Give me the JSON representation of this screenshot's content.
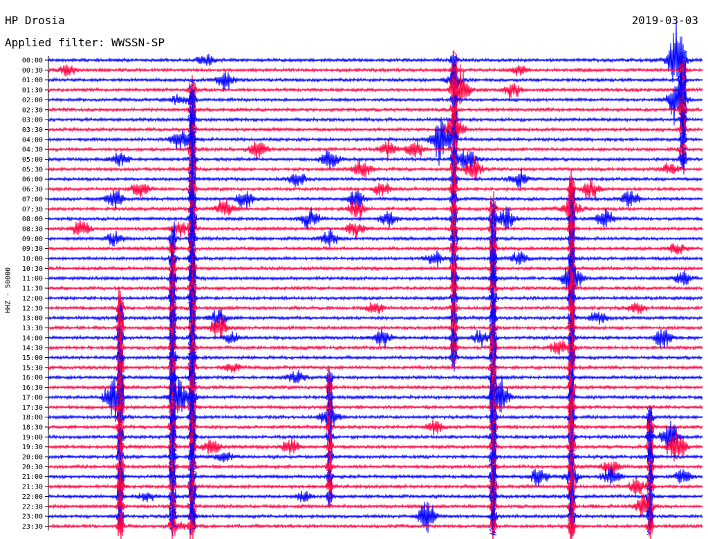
{
  "header": {
    "station": "HP Drosia",
    "date": "2019-03-03",
    "filter": "Applied filter: WWSSN-SP"
  },
  "colors": {
    "blue": "#0000ff",
    "red": "#ff0040",
    "axis": "#000000"
  },
  "chart_data": {
    "type": "line",
    "title": "HP Drosia",
    "ylabel": "HHZ - 50000",
    "row_labels": [
      "00:00",
      "00:30",
      "01:00",
      "01:30",
      "02:00",
      "02:30",
      "03:00",
      "03:30",
      "04:00",
      "04:30",
      "05:00",
      "05:30",
      "06:00",
      "06:30",
      "07:00",
      "07:30",
      "08:00",
      "08:30",
      "09:00",
      "09:30",
      "10:00",
      "10:30",
      "11:00",
      "11:30",
      "12:00",
      "12:30",
      "13:00",
      "13:30",
      "14:00",
      "14:30",
      "15:00",
      "15:30",
      "16:00",
      "16:30",
      "17:00",
      "17:30",
      "18:00",
      "18:30",
      "19:00",
      "19:30",
      "20:00",
      "20:30",
      "21:00",
      "21:30",
      "22:00",
      "22:30",
      "23:00",
      "23:30"
    ],
    "row_colors": [
      "blue",
      "red"
    ],
    "grid": false,
    "legend": "none",
    "events": [
      {
        "row": 0,
        "x": 0.24,
        "amp": 8
      },
      {
        "row": 0,
        "x": 0.96,
        "amp": 40
      },
      {
        "row": 1,
        "x": 0.03,
        "amp": 8
      },
      {
        "row": 1,
        "x": 0.72,
        "amp": 6
      },
      {
        "row": 2,
        "x": 0.27,
        "amp": 12
      },
      {
        "row": 2,
        "x": 0.62,
        "amp": 8
      },
      {
        "row": 3,
        "x": 0.71,
        "amp": 12
      },
      {
        "row": 3,
        "x": 0.63,
        "amp": 30
      },
      {
        "row": 4,
        "x": 0.2,
        "amp": 6
      },
      {
        "row": 4,
        "x": 0.96,
        "amp": 30
      },
      {
        "row": 7,
        "x": 0.62,
        "amp": 25
      },
      {
        "row": 8,
        "x": 0.6,
        "amp": 30
      },
      {
        "row": 8,
        "x": 0.2,
        "amp": 14
      },
      {
        "row": 9,
        "x": 0.32,
        "amp": 12
      },
      {
        "row": 9,
        "x": 0.52,
        "amp": 10
      },
      {
        "row": 9,
        "x": 0.56,
        "amp": 12
      },
      {
        "row": 10,
        "x": 0.11,
        "amp": 10
      },
      {
        "row": 10,
        "x": 0.43,
        "amp": 14
      },
      {
        "row": 10,
        "x": 0.64,
        "amp": 18
      },
      {
        "row": 11,
        "x": 0.48,
        "amp": 12
      },
      {
        "row": 11,
        "x": 0.95,
        "amp": 8
      },
      {
        "row": 11,
        "x": 0.65,
        "amp": 16
      },
      {
        "row": 12,
        "x": 0.72,
        "amp": 12
      },
      {
        "row": 12,
        "x": 0.38,
        "amp": 10
      },
      {
        "row": 13,
        "x": 0.14,
        "amp": 10
      },
      {
        "row": 13,
        "x": 0.51,
        "amp": 10
      },
      {
        "row": 13,
        "x": 0.83,
        "amp": 14
      },
      {
        "row": 14,
        "x": 0.1,
        "amp": 14
      },
      {
        "row": 14,
        "x": 0.3,
        "amp": 12
      },
      {
        "row": 14,
        "x": 0.47,
        "amp": 12
      },
      {
        "row": 14,
        "x": 0.89,
        "amp": 12
      },
      {
        "row": 15,
        "x": 0.27,
        "amp": 14
      },
      {
        "row": 15,
        "x": 0.47,
        "amp": 12
      },
      {
        "row": 15,
        "x": 0.8,
        "amp": 16
      },
      {
        "row": 16,
        "x": 0.4,
        "amp": 14
      },
      {
        "row": 16,
        "x": 0.52,
        "amp": 10
      },
      {
        "row": 16,
        "x": 0.7,
        "amp": 14
      },
      {
        "row": 16,
        "x": 0.85,
        "amp": 14
      },
      {
        "row": 17,
        "x": 0.05,
        "amp": 12
      },
      {
        "row": 17,
        "x": 0.2,
        "amp": 12
      },
      {
        "row": 17,
        "x": 0.47,
        "amp": 12
      },
      {
        "row": 18,
        "x": 0.1,
        "amp": 10
      },
      {
        "row": 18,
        "x": 0.43,
        "amp": 12
      },
      {
        "row": 19,
        "x": 0.96,
        "amp": 8
      },
      {
        "row": 20,
        "x": 0.59,
        "amp": 10
      },
      {
        "row": 20,
        "x": 0.72,
        "amp": 10
      },
      {
        "row": 22,
        "x": 0.97,
        "amp": 10
      },
      {
        "row": 22,
        "x": 0.8,
        "amp": 30
      },
      {
        "row": 25,
        "x": 0.5,
        "amp": 8
      },
      {
        "row": 25,
        "x": 0.9,
        "amp": 8
      },
      {
        "row": 26,
        "x": 0.26,
        "amp": 12
      },
      {
        "row": 26,
        "x": 0.84,
        "amp": 8
      },
      {
        "row": 27,
        "x": 0.26,
        "amp": 14
      },
      {
        "row": 28,
        "x": 0.28,
        "amp": 8
      },
      {
        "row": 28,
        "x": 0.51,
        "amp": 12
      },
      {
        "row": 28,
        "x": 0.66,
        "amp": 10
      },
      {
        "row": 28,
        "x": 0.94,
        "amp": 12
      },
      {
        "row": 29,
        "x": 0.78,
        "amp": 12
      },
      {
        "row": 31,
        "x": 0.28,
        "amp": 6
      },
      {
        "row": 32,
        "x": 0.38,
        "amp": 10
      },
      {
        "row": 34,
        "x": 0.1,
        "amp": 30
      },
      {
        "row": 34,
        "x": 0.2,
        "amp": 30
      },
      {
        "row": 34,
        "x": 0.69,
        "amp": 30
      },
      {
        "row": 36,
        "x": 0.43,
        "amp": 20
      },
      {
        "row": 37,
        "x": 0.59,
        "amp": 8
      },
      {
        "row": 38,
        "x": 0.95,
        "amp": 22
      },
      {
        "row": 39,
        "x": 0.25,
        "amp": 12
      },
      {
        "row": 39,
        "x": 0.37,
        "amp": 12
      },
      {
        "row": 39,
        "x": 0.96,
        "amp": 20
      },
      {
        "row": 40,
        "x": 0.27,
        "amp": 8
      },
      {
        "row": 41,
        "x": 0.86,
        "amp": 10
      },
      {
        "row": 42,
        "x": 0.75,
        "amp": 12
      },
      {
        "row": 42,
        "x": 0.8,
        "amp": 8
      },
      {
        "row": 42,
        "x": 0.86,
        "amp": 12
      },
      {
        "row": 42,
        "x": 0.97,
        "amp": 10
      },
      {
        "row": 43,
        "x": 0.9,
        "amp": 12
      },
      {
        "row": 44,
        "x": 0.15,
        "amp": 6
      },
      {
        "row": 44,
        "x": 0.39,
        "amp": 6
      },
      {
        "row": 45,
        "x": 0.91,
        "amp": 14
      },
      {
        "row": 46,
        "x": 0.58,
        "amp": 22
      },
      {
        "row": 47,
        "x": 0.2,
        "amp": 6
      }
    ],
    "spikes": [
      {
        "x": 0.22,
        "row_start": 3,
        "row_end": 47,
        "amp": 14
      },
      {
        "x": 0.11,
        "row_start": 25,
        "row_end": 47,
        "amp": 12
      },
      {
        "x": 0.19,
        "row_start": 18,
        "row_end": 47,
        "amp": 12
      },
      {
        "x": 0.62,
        "row_start": 0,
        "row_end": 30,
        "amp": 10
      },
      {
        "x": 0.68,
        "row_start": 15,
        "row_end": 47,
        "amp": 12
      },
      {
        "x": 0.8,
        "row_start": 13,
        "row_end": 47,
        "amp": 12
      },
      {
        "x": 0.97,
        "row_start": 0,
        "row_end": 10,
        "amp": 12
      },
      {
        "x": 0.43,
        "row_start": 32,
        "row_end": 44,
        "amp": 8
      },
      {
        "x": 0.92,
        "row_start": 36,
        "row_end": 47,
        "amp": 10
      }
    ]
  }
}
